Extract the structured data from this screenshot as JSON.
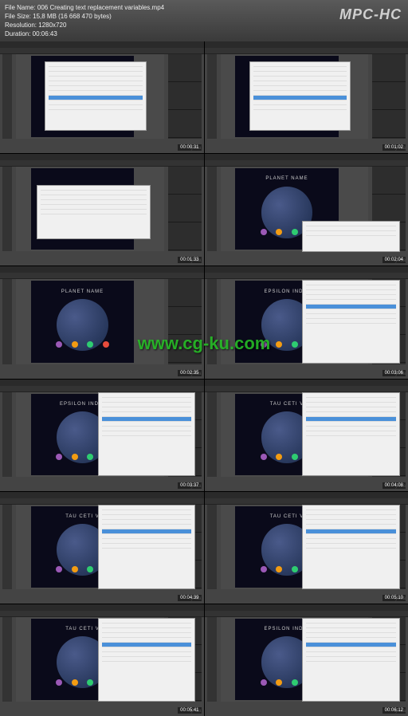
{
  "header": {
    "line1": "File Name: 006 Creating text replacement variables.mp4",
    "line2": "File Size: 15,8 MB (16 668 470 bytes)",
    "line3": "Resolution: 1280x720",
    "line4": "Duration: 00:06:43",
    "logo": "MPC-HC"
  },
  "watermark": "www.cg-ku.com",
  "thumbs": [
    {
      "ts": "00:00:31",
      "style": "dialog-list",
      "planet_title": ""
    },
    {
      "ts": "00:01:02",
      "style": "dialog-list",
      "planet_title": ""
    },
    {
      "ts": "00:01:33",
      "style": "dialog-form",
      "planet_title": ""
    },
    {
      "ts": "00:02:04",
      "style": "planet-dialog-small",
      "planet_title": "PLANET NAME"
    },
    {
      "ts": "00:02:35",
      "style": "planet-full",
      "planet_title": "PLANET NAME"
    },
    {
      "ts": "00:03:06",
      "style": "planet-dialog",
      "planet_title": "EPSILON INDI I"
    },
    {
      "ts": "00:03:37",
      "style": "planet-dialog",
      "planet_title": "EPSILON INDI I"
    },
    {
      "ts": "00:04:08",
      "style": "planet-dialog",
      "planet_title": "TAU CETI V"
    },
    {
      "ts": "00:04:39",
      "style": "planet-dialog",
      "planet_title": "TAU CETI V"
    },
    {
      "ts": "00:05:10",
      "style": "planet-dialog",
      "planet_title": "TAU CETI V"
    },
    {
      "ts": "00:05:41",
      "style": "planet-dialog",
      "planet_title": "TAU CETI V"
    },
    {
      "ts": "00:06:12",
      "style": "planet-dialog",
      "planet_title": "EPSILON INDI I"
    }
  ]
}
